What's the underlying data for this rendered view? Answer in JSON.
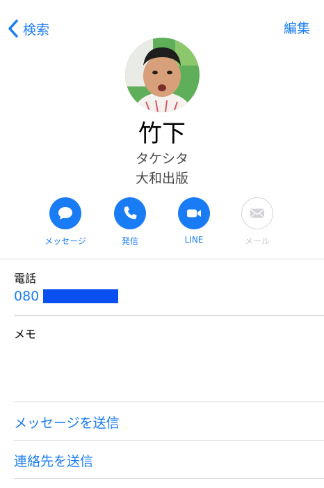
{
  "nav": {
    "back_label": "検索",
    "edit_label": "編集"
  },
  "contact": {
    "name": "竹下",
    "kana": "タケシタ",
    "company": "大和出版"
  },
  "actions": [
    {
      "label": "メッセージ",
      "icon": "message-bubble-icon",
      "enabled": true
    },
    {
      "label": "発信",
      "icon": "phone-icon",
      "enabled": true
    },
    {
      "label": "LINE",
      "icon": "video-icon",
      "enabled": true
    },
    {
      "label": "メール",
      "icon": "mail-icon",
      "enabled": false
    }
  ],
  "phone": {
    "label": "電話",
    "value_visible": "080"
  },
  "memo": {
    "label": "メモ"
  },
  "links": {
    "send_message": "メッセージを送信",
    "send_contact": "連絡先を送信"
  },
  "colors": {
    "accent": "#1a7cf5",
    "disabled": "#c7c7cc",
    "redaction": "#0a4ff0"
  }
}
